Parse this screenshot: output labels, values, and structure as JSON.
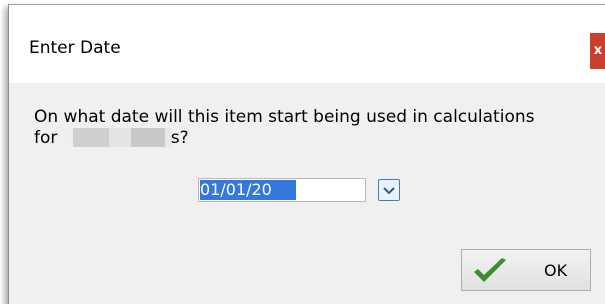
{
  "dialog": {
    "title": "Enter Date",
    "close_label": "x",
    "prompt_line1": "On what date will this item start being used in calculations",
    "prompt_line2_start": "for ",
    "prompt_line2_end": "s?",
    "date_value": "01/01/20",
    "ok_label": "OK"
  },
  "icons": {
    "dropdown": "chevron-down-icon",
    "ok": "checkmark-icon"
  },
  "colors": {
    "close": "#c7402f",
    "selection": "#3478dd",
    "check": "#3d8c2f"
  }
}
